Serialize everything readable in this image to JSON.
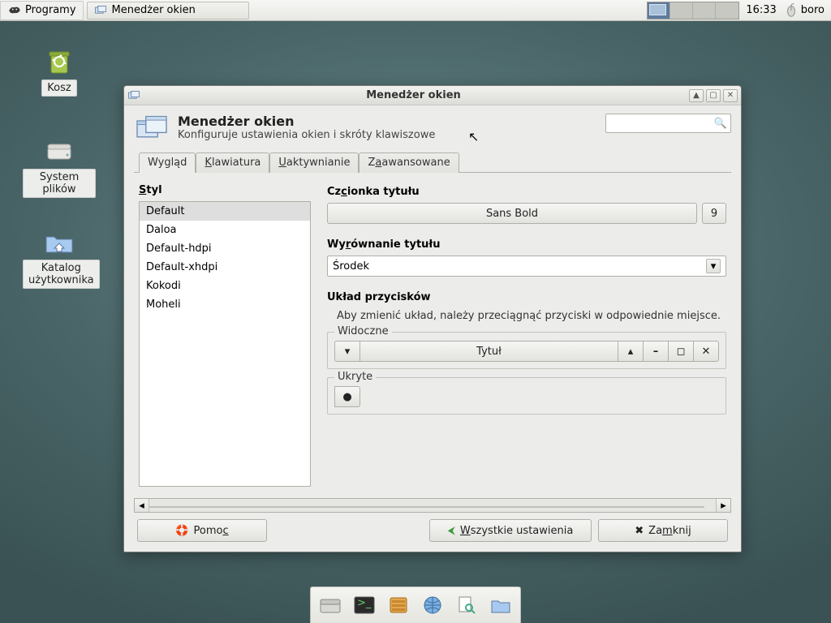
{
  "panel": {
    "menu_label": "Programy",
    "task_label": "Menedżer okien",
    "clock": "16:33",
    "user": "boro"
  },
  "desktop": {
    "trash": "Kosz",
    "filesystem": "System plików",
    "home": "Katalog użytkownika"
  },
  "window": {
    "title": "Menedżer okien",
    "header_title": "Menedżer okien",
    "header_sub": "Konfiguruje ustawienia okien i skróty klawiszowe",
    "tabs": {
      "t0": "Wygląd",
      "t1_pre": "K",
      "t1_rest": "lawiatura",
      "t2_pre": "U",
      "t2_rest": "aktywnianie",
      "t3_pre": "Z",
      "t3_mid": "a",
      "t3_rest": "awansowane"
    },
    "style_heading_pre": "S",
    "style_heading_rest": "tyl",
    "styles": {
      "s0": "Default",
      "s1": "Daloa",
      "s2": "Default-hdpi",
      "s3": "Default-xhdpi",
      "s4": "Kokodi",
      "s5": "Moheli"
    },
    "font_heading_pre": "Cz",
    "font_heading_mid": "c",
    "font_heading_rest": "ionka tytułu",
    "font_name": "Sans Bold",
    "font_size": "9",
    "align_heading_pre": "Wy",
    "align_heading_mid": "r",
    "align_heading_rest": "ównanie tytułu",
    "align_value": "Środek",
    "layout_heading": "Układ przycisków",
    "layout_hint": "Aby zmienić układ, należy przeciągnąć przyciski w odpowiednie miejsce.",
    "visible_legend": "Widoczne",
    "visible_title": "Tytuł",
    "hidden_legend": "Ukryte",
    "help_pre": "Pomo",
    "help_mid": "c",
    "all_pre": "W",
    "all_rest": "szystkie ustawienia",
    "close_pre": "Za",
    "close_mid": "m",
    "close_rest": "knij"
  }
}
